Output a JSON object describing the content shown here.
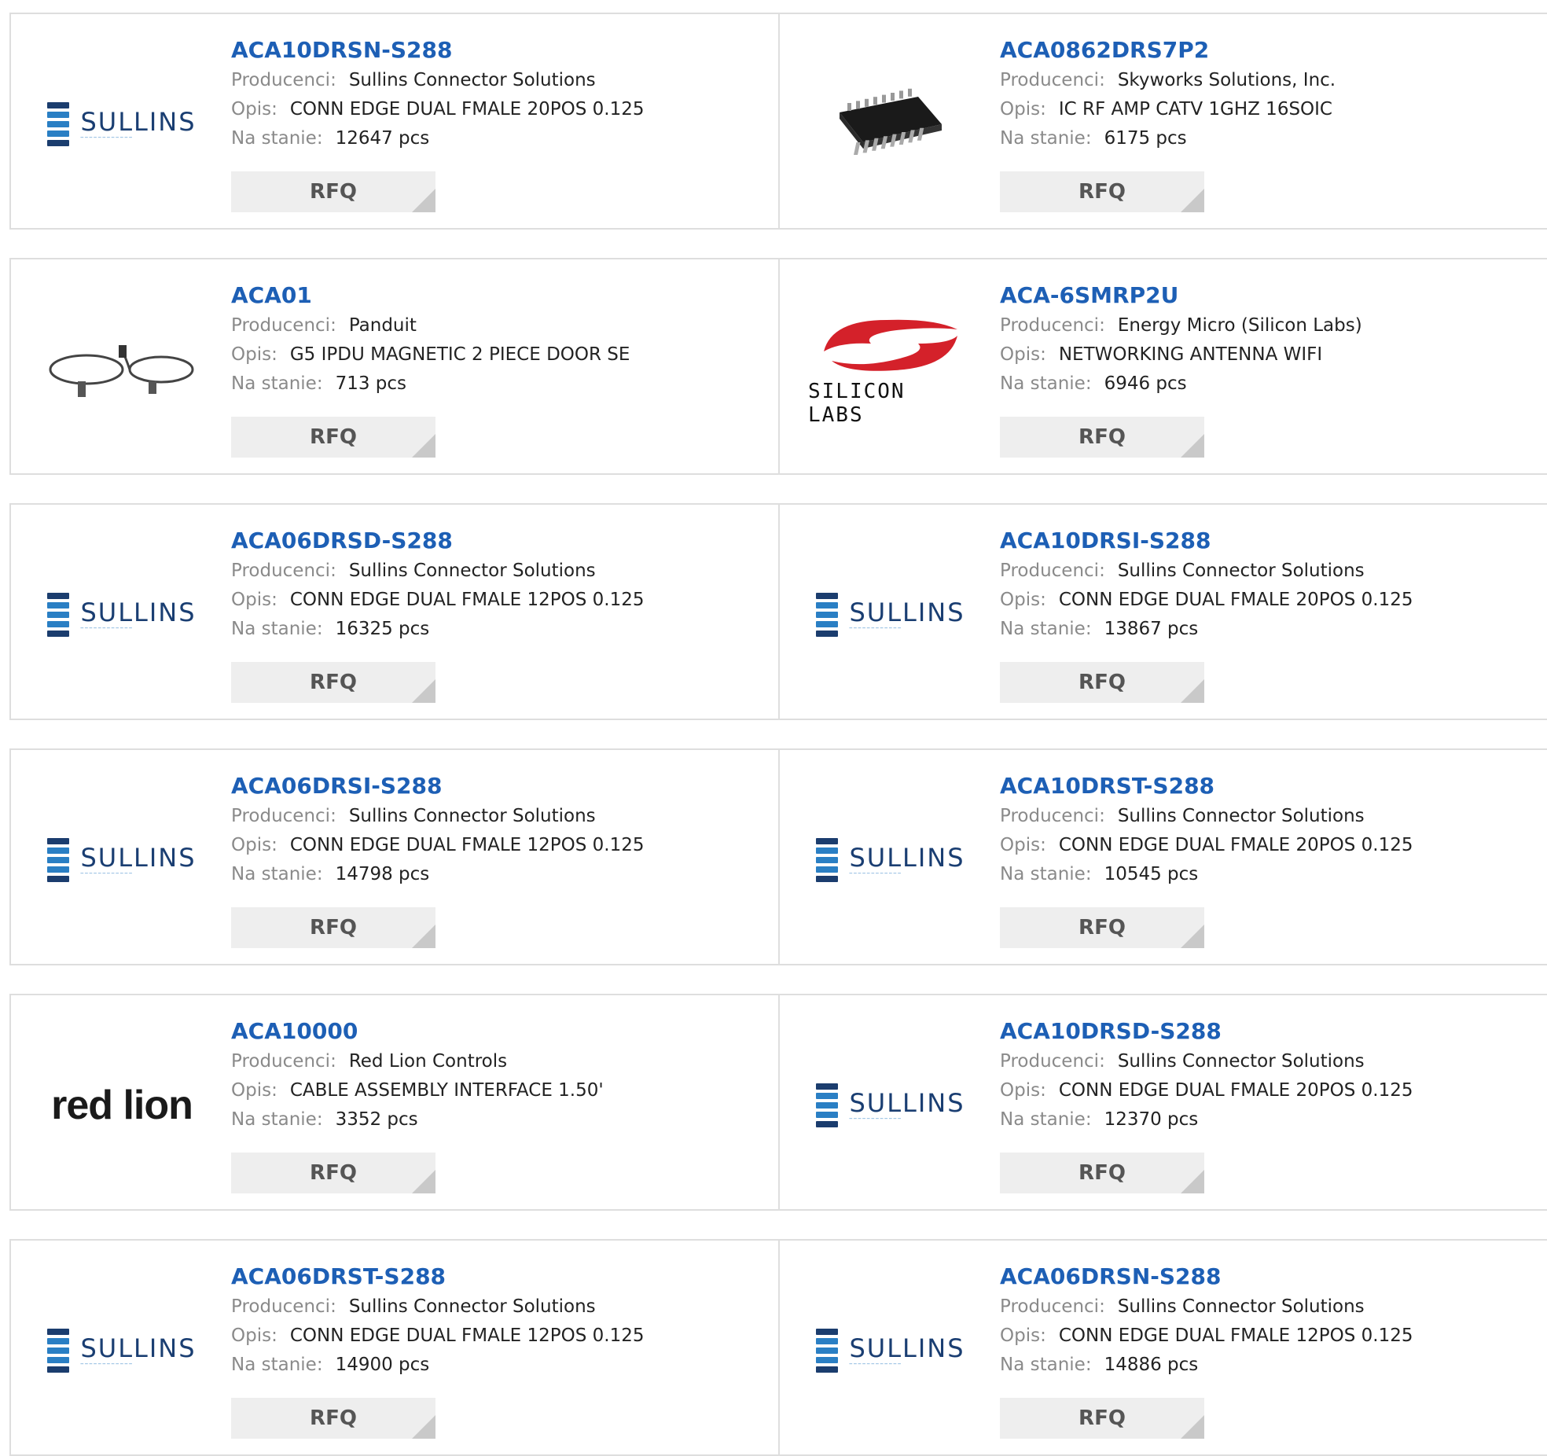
{
  "labels": {
    "manufacturer": "Producenci:",
    "description": "Opis:",
    "stock": "Na stanie:",
    "rfq": "RFQ"
  },
  "colors": {
    "part_link": "#1d5fb5",
    "rfq_bg": "#eeeeee",
    "border": "#dedede",
    "sullins_blue": "#2a7fc4"
  },
  "products": [
    {
      "part": "ACA10DRSN-S288",
      "manufacturer": "Sullins Connector Solutions",
      "description": "CONN EDGE DUAL FMALE 20POS 0.125",
      "stock": "12647 pcs",
      "logo": "sullins",
      "logo_text": "SULLINS"
    },
    {
      "part": "ACA0862DRS7P2",
      "manufacturer": "Skyworks Solutions, Inc.",
      "description": "IC RF AMP CATV 1GHZ 16SOIC",
      "stock": "6175 pcs",
      "logo": "ic-chip"
    },
    {
      "part": "ACA01",
      "manufacturer": "Panduit",
      "description": "G5 IPDU MAGNETIC 2 PIECE DOOR SE",
      "stock": "713 pcs",
      "logo": "cable"
    },
    {
      "part": "ACA-6SMRP2U",
      "manufacturer": "Energy Micro (Silicon Labs)",
      "description": "NETWORKING ANTENNA WIFI",
      "stock": "6946 pcs",
      "logo": "silicon-labs",
      "logo_text": "SILICON LABS"
    },
    {
      "part": "ACA06DRSD-S288",
      "manufacturer": "Sullins Connector Solutions",
      "description": "CONN EDGE DUAL FMALE 12POS 0.125",
      "stock": "16325 pcs",
      "logo": "sullins",
      "logo_text": "SULLINS"
    },
    {
      "part": "ACA10DRSI-S288",
      "manufacturer": "Sullins Connector Solutions",
      "description": "CONN EDGE DUAL FMALE 20POS 0.125",
      "stock": "13867 pcs",
      "logo": "sullins",
      "logo_text": "SULLINS"
    },
    {
      "part": "ACA06DRSI-S288",
      "manufacturer": "Sullins Connector Solutions",
      "description": "CONN EDGE DUAL FMALE 12POS 0.125",
      "stock": "14798 pcs",
      "logo": "sullins",
      "logo_text": "SULLINS"
    },
    {
      "part": "ACA10DRST-S288",
      "manufacturer": "Sullins Connector Solutions",
      "description": "CONN EDGE DUAL FMALE 20POS 0.125",
      "stock": "10545 pcs",
      "logo": "sullins",
      "logo_text": "SULLINS"
    },
    {
      "part": "ACA10000",
      "manufacturer": "Red Lion Controls",
      "description": "CABLE ASSEMBLY INTERFACE 1.50'",
      "stock": "3352 pcs",
      "logo": "red-lion",
      "logo_text": "red lion"
    },
    {
      "part": "ACA10DRSD-S288",
      "manufacturer": "Sullins Connector Solutions",
      "description": "CONN EDGE DUAL FMALE 20POS 0.125",
      "stock": "12370 pcs",
      "logo": "sullins",
      "logo_text": "SULLINS"
    },
    {
      "part": "ACA06DRST-S288",
      "manufacturer": "Sullins Connector Solutions",
      "description": "CONN EDGE DUAL FMALE 12POS 0.125",
      "stock": "14900 pcs",
      "logo": "sullins",
      "logo_text": "SULLINS"
    },
    {
      "part": "ACA06DRSN-S288",
      "manufacturer": "Sullins Connector Solutions",
      "description": "CONN EDGE DUAL FMALE 12POS 0.125",
      "stock": "14886 pcs",
      "logo": "sullins",
      "logo_text": "SULLINS"
    }
  ]
}
